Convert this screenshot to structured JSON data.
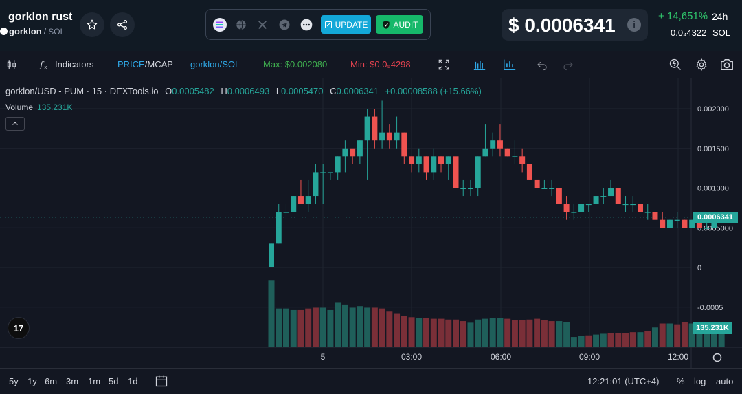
{
  "header": {
    "token_name": "gorklon rust",
    "token_symbol": "gorklon",
    "separator": "/",
    "quote": "SOL",
    "social_update_label": "UPDATE",
    "social_audit_label": "AUDIT",
    "price": "$ 0.0006341",
    "info_glyph": "i",
    "change_pct": "+ 14,651%",
    "change_period": "24h",
    "sol_price": "0.0₄4322",
    "sol_label": "SOL"
  },
  "toolbar": {
    "indicators_label": "Indicators",
    "price_label": "PRICE",
    "slash": "/",
    "mcap_label": "MCAP",
    "pair_label": "gorklon/SOL",
    "max_label": "Max: $0.002080",
    "min_label": "Min: $0.0₅4298"
  },
  "legend": {
    "symbol": "gorklon/USD - PUM · 15 · DEXTools.io",
    "o_key": "O",
    "o_val": "0.0005482",
    "h_key": "H",
    "h_val": "0.0006493",
    "l_key": "L",
    "l_val": "0.0005470",
    "c_key": "C",
    "c_val": "0.0006341",
    "change": "+0.00008588 (+15.66%)",
    "volume_label": "Volume",
    "volume_val": "135.231K",
    "tv_logo": "17"
  },
  "chart_data": {
    "type": "candlestick",
    "y_ticks": [
      "0.002000",
      "0.001500",
      "0.001000",
      "0.0005000",
      "0",
      "-0.0005"
    ],
    "y_tick_values": [
      0.002,
      0.0015,
      0.001,
      0.0005,
      0,
      -0.0005
    ],
    "x_ticks": [
      "5",
      "03:00",
      "06:00",
      "09:00",
      "12:00"
    ],
    "last_price_label": "0.0006341",
    "last_volume_label": "135.231K",
    "colors": {
      "up": "#26a69a",
      "down": "#ef5350",
      "up_vol": "#1f5f5a",
      "down_vol": "#7a2f38"
    },
    "candles": [
      [
        0.0,
        0.0003,
        0.0,
        0.0003
      ],
      [
        0.0003,
        0.0008,
        0.0003,
        0.0007
      ],
      [
        0.0007,
        0.0008,
        0.0006,
        0.0007
      ],
      [
        0.0007,
        0.0009,
        0.0007,
        0.0009
      ],
      [
        0.0009,
        0.0011,
        0.0008,
        0.0008
      ],
      [
        0.0008,
        0.0011,
        0.0007,
        0.0009
      ],
      [
        0.0009,
        0.0013,
        0.0008,
        0.0012
      ],
      [
        0.0012,
        0.0013,
        0.0008,
        0.0012
      ],
      [
        0.0012,
        0.0012,
        0.0011,
        0.0012
      ],
      [
        0.0012,
        0.0014,
        0.0011,
        0.0014
      ],
      [
        0.0014,
        0.0016,
        0.0012,
        0.0015
      ],
      [
        0.0015,
        0.0014,
        0.0013,
        0.0014
      ],
      [
        0.0014,
        0.0016,
        0.0013,
        0.0016
      ],
      [
        0.0016,
        0.002,
        0.0011,
        0.0019
      ],
      [
        0.0019,
        0.002,
        0.0015,
        0.0016
      ],
      [
        0.0016,
        0.0021,
        0.0015,
        0.0017
      ],
      [
        0.0017,
        0.0018,
        0.0015,
        0.0016
      ],
      [
        0.0016,
        0.0019,
        0.0015,
        0.0017
      ],
      [
        0.0017,
        0.0017,
        0.0013,
        0.0014
      ],
      [
        0.0014,
        0.0014,
        0.0012,
        0.0013
      ],
      [
        0.0013,
        0.0015,
        0.0012,
        0.0014
      ],
      [
        0.0014,
        0.0014,
        0.0011,
        0.0012
      ],
      [
        0.0012,
        0.0015,
        0.0011,
        0.0014
      ],
      [
        0.0014,
        0.0014,
        0.0012,
        0.0013
      ],
      [
        0.0013,
        0.0014,
        0.0011,
        0.0014
      ],
      [
        0.0014,
        0.0014,
        0.001,
        0.001
      ],
      [
        0.001,
        0.0011,
        0.0009,
        0.001
      ],
      [
        0.001,
        0.0011,
        0.0009,
        0.001
      ],
      [
        0.001,
        0.0014,
        0.0009,
        0.0014
      ],
      [
        0.0014,
        0.0018,
        0.0014,
        0.0015
      ],
      [
        0.0015,
        0.0017,
        0.0014,
        0.0016
      ],
      [
        0.0016,
        0.0018,
        0.0014,
        0.0015
      ],
      [
        0.0015,
        0.0015,
        0.0014,
        0.0014
      ],
      [
        0.0014,
        0.0016,
        0.0013,
        0.0014
      ],
      [
        0.0014,
        0.0015,
        0.0012,
        0.0013
      ],
      [
        0.0013,
        0.0013,
        0.0011,
        0.0011
      ],
      [
        0.0011,
        0.0011,
        0.001,
        0.001
      ],
      [
        0.001,
        0.0011,
        0.001,
        0.001
      ],
      [
        0.001,
        0.0011,
        0.0009,
        0.001
      ],
      [
        0.001,
        0.001,
        0.0008,
        0.0008
      ],
      [
        0.0008,
        0.0009,
        0.0006,
        0.0007
      ],
      [
        0.0007,
        0.0008,
        0.0006,
        0.0007
      ],
      [
        0.0007,
        0.0008,
        0.0007,
        0.0008
      ],
      [
        0.0008,
        0.0008,
        0.0007,
        0.0008
      ],
      [
        0.0008,
        0.0009,
        0.0008,
        0.0009
      ],
      [
        0.0009,
        0.001,
        0.0008,
        0.0009
      ],
      [
        0.0009,
        0.0011,
        0.0009,
        0.001
      ],
      [
        0.001,
        0.001,
        0.0008,
        0.0008
      ],
      [
        0.0008,
        0.0009,
        0.0007,
        0.0008
      ],
      [
        0.0008,
        0.0009,
        0.0007,
        0.0008
      ],
      [
        0.0008,
        0.0008,
        0.0007,
        0.0007
      ],
      [
        0.0007,
        0.0008,
        0.0006,
        0.0007
      ],
      [
        0.0007,
        0.0007,
        0.0006,
        0.0006
      ],
      [
        0.0006,
        0.0007,
        0.0005,
        0.0005
      ],
      [
        0.0005,
        0.0006,
        0.0005,
        0.0006
      ],
      [
        0.0006,
        0.0007,
        0.0005,
        0.0006
      ],
      [
        0.0006,
        0.0006,
        0.0005,
        0.0005
      ],
      [
        0.0005,
        0.0006,
        0.0005,
        0.0006
      ],
      [
        0.0006,
        0.0006,
        0.0005,
        0.0005
      ],
      [
        0.0005,
        0.0006,
        0.0005,
        0.0005
      ],
      [
        0.0005,
        0.0006,
        0.0005,
        0.00063
      ]
    ],
    "volumes_rel": [
      0.85,
      0.49,
      0.49,
      0.47,
      0.47,
      0.49,
      0.5,
      0.5,
      0.47,
      0.57,
      0.54,
      0.5,
      0.52,
      0.5,
      0.5,
      0.49,
      0.45,
      0.43,
      0.4,
      0.38,
      0.37,
      0.37,
      0.36,
      0.36,
      0.35,
      0.35,
      0.33,
      0.31,
      0.35,
      0.36,
      0.37,
      0.37,
      0.36,
      0.34,
      0.34,
      0.35,
      0.36,
      0.34,
      0.33,
      0.33,
      0.32,
      0.13,
      0.14,
      0.15,
      0.16,
      0.17,
      0.18,
      0.18,
      0.18,
      0.19,
      0.19,
      0.2,
      0.25,
      0.3,
      0.3,
      0.29,
      0.32,
      0.3,
      0.28,
      0.21,
      0.3,
      0.26
    ],
    "volumes_up": [
      true,
      true,
      true,
      true,
      false,
      false,
      false,
      true,
      true,
      true,
      true,
      true,
      true,
      true,
      false,
      false,
      false,
      false,
      false,
      false,
      true,
      false,
      false,
      false,
      false,
      false,
      false,
      true,
      true,
      true,
      true,
      true,
      false,
      false,
      false,
      false,
      false,
      false,
      false,
      true,
      true,
      true,
      true,
      false,
      true,
      true,
      false,
      false,
      false,
      false,
      true,
      false,
      true,
      false,
      true,
      false,
      false,
      true,
      true,
      true,
      true,
      true
    ]
  },
  "bottom": {
    "ranges": [
      "5y",
      "1y",
      "6m",
      "3m",
      "1m",
      "5d",
      "1d"
    ],
    "time": "12:21:01 (UTC+4)",
    "pct": "%",
    "log": "log",
    "auto": "auto"
  }
}
